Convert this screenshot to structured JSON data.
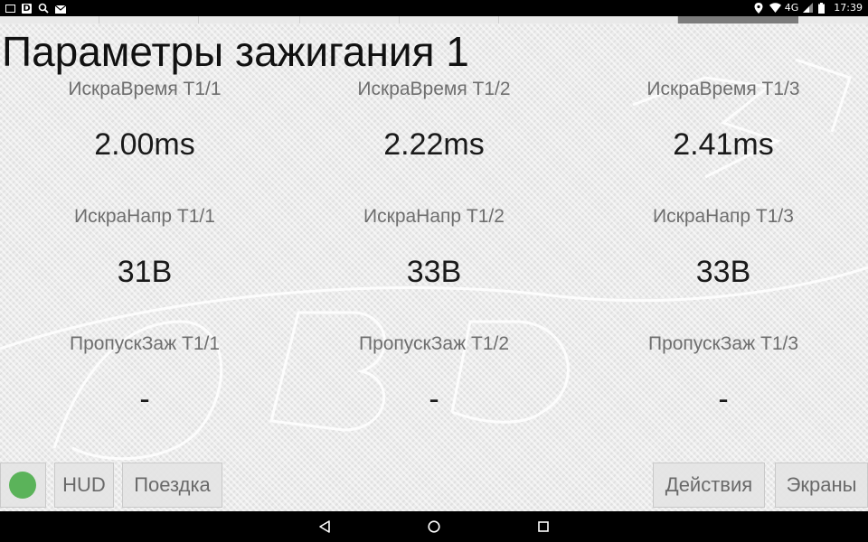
{
  "status_bar": {
    "left_icons": [
      "image-icon",
      "d-app-icon",
      "search-icon",
      "mail-icon"
    ],
    "d_app_letter": "D",
    "right_icons": [
      "location-icon",
      "wifi-icon",
      "signal-icon",
      "battery-icon"
    ],
    "network_label": "4G",
    "time": "17:39"
  },
  "tabs": {
    "count": 8,
    "active_index": 6
  },
  "page": {
    "title": "Параметры зажигания 1"
  },
  "gauges": [
    {
      "label": "ИскраВремя Т1/1",
      "value": "2.00ms"
    },
    {
      "label": "ИскраВремя Т1/2",
      "value": "2.22ms"
    },
    {
      "label": "ИскраВремя Т1/3",
      "value": "2.41ms"
    },
    {
      "label": "ИскраНапр Т1/1",
      "value": "31В"
    },
    {
      "label": "ИскраНапр Т1/2",
      "value": "33В"
    },
    {
      "label": "ИскраНапр Т1/3",
      "value": "33В"
    },
    {
      "label": "ПропускЗаж Т1/1",
      "value": "-"
    },
    {
      "label": "ПропускЗаж Т1/2",
      "value": "-"
    },
    {
      "label": "ПропускЗаж Т1/3",
      "value": "-"
    }
  ],
  "toolbar": {
    "status_color": "#5bb35a",
    "hud_label": "HUD",
    "trip_label": "Поездка",
    "actions_label": "Действия",
    "screens_label": "Экраны"
  },
  "nav": {
    "icons": [
      "back-icon",
      "home-icon",
      "recents-icon"
    ]
  }
}
